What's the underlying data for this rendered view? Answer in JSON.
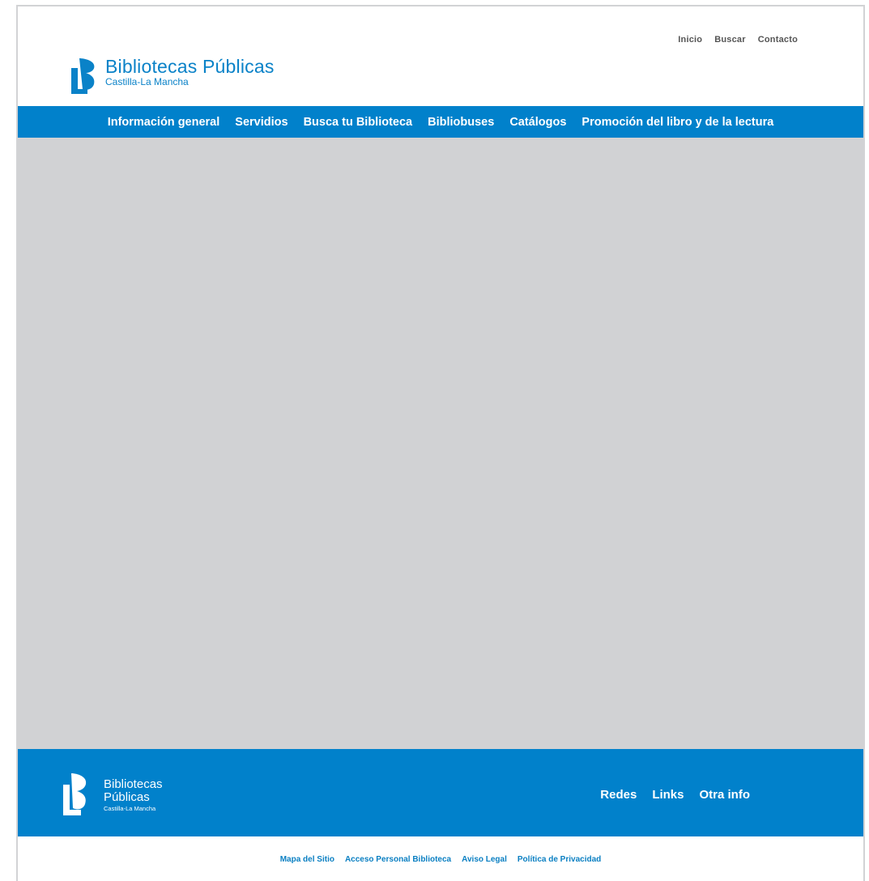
{
  "top_links": [
    {
      "label": "Inicio"
    },
    {
      "label": "Buscar"
    },
    {
      "label": "Contacto"
    }
  ],
  "logo": {
    "title": "Bibliotecas Públicas",
    "subtitle": "Castilla-La Mancha"
  },
  "nav": [
    {
      "label": "Información general"
    },
    {
      "label": "Servidios"
    },
    {
      "label": "Busca tu Biblioteca"
    },
    {
      "label": "Bibliobuses"
    },
    {
      "label": "Catálogos"
    },
    {
      "label": "Promoción del libro y de la lectura"
    }
  ],
  "footer": {
    "logo_title_1": "Bibliotecas",
    "logo_title_2": "Públicas",
    "logo_subtitle": "Castilla-La Mancha",
    "links": [
      {
        "label": "Redes"
      },
      {
        "label": "Links"
      },
      {
        "label": "Otra info"
      }
    ]
  },
  "legal_links": [
    {
      "label": "Mapa del Sitio"
    },
    {
      "label": "Acceso Personal Biblioteca"
    },
    {
      "label": "Aviso Legal"
    },
    {
      "label": "Política de Privacidad"
    }
  ],
  "colors": {
    "brand_blue": "#0181cb",
    "content_gray": "#d1d2d4"
  },
  "icons": {
    "logo": "library-logo-icon",
    "footer_logo": "library-logo-icon-white"
  }
}
